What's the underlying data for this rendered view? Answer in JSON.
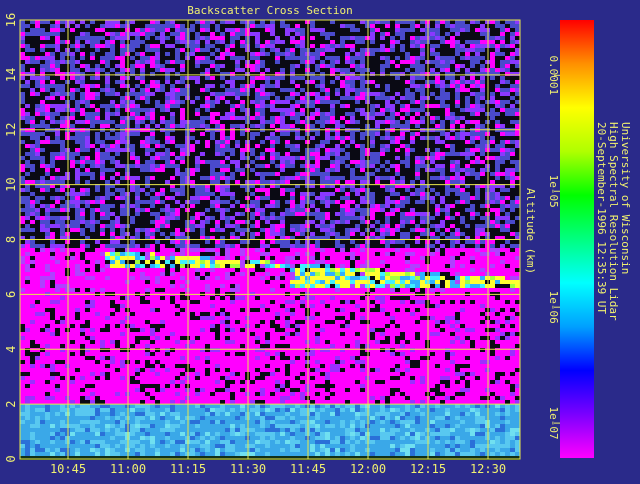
{
  "chart_data": {
    "type": "heatmap",
    "title": "Backscatter Cross Section",
    "ylabel": "Altitude (km)",
    "xlabel": "",
    "x_ticks": [
      "10:45",
      "11:00",
      "11:15",
      "11:30",
      "11:45",
      "12:00",
      "12:15",
      "12:30"
    ],
    "x_tick_minutes": [
      645,
      660,
      675,
      690,
      705,
      720,
      735,
      750
    ],
    "xlim_minutes": [
      633,
      758
    ],
    "y_ticks": [
      "0",
      "2",
      "4",
      "6",
      "8",
      "10",
      "12",
      "14",
      "16"
    ],
    "y_tick_values": [
      0,
      2,
      4,
      6,
      8,
      10,
      12,
      14,
      16
    ],
    "ylim": [
      0,
      16
    ],
    "grid": true,
    "colorbar": {
      "scale": "log",
      "range": [
        5e-08,
        0.0003
      ],
      "ticks": [
        "0.0001",
        "1e-05",
        "1e-06",
        "1e-07"
      ],
      "tick_values": [
        0.0001,
        1e-05,
        1e-06,
        1e-07
      ],
      "colors": [
        "#ff00ff",
        "#7a00ff",
        "#0000ff",
        "#00a0ff",
        "#00ffff",
        "#00ff80",
        "#00ff00",
        "#b0ff00",
        "#ffff00",
        "#ff9000",
        "#ff0000"
      ]
    },
    "annotation_lines": [
      "University of Wisconsin",
      "High Spectral Resolution Lidar",
      "20-September-1996 12:35:39 UT"
    ],
    "layers": [
      {
        "name": "",
        "alt_range_km": [
          0.1,
          2.1
        ],
        "level": 6e-07
      },
      {
        "name": "",
        "alt_range_km": [
          6.3,
          7.6
        ],
        "level": 3e-05
      },
      {
        "name": "",
        "alt_range_km": [
          2.1,
          6.0
        ],
        "level": 8e-08
      },
      {
        "name": "",
        "alt_range_km": [
          8.0,
          16.0
        ],
        "level": 5e-08
      }
    ]
  },
  "colors": {
    "background": "#2a2a8a",
    "grid": "#e8e84a",
    "text": "#f0f070",
    "low_signal": "#ff00ff",
    "noise": "#4a4acc",
    "dark": "#0a0a14"
  }
}
